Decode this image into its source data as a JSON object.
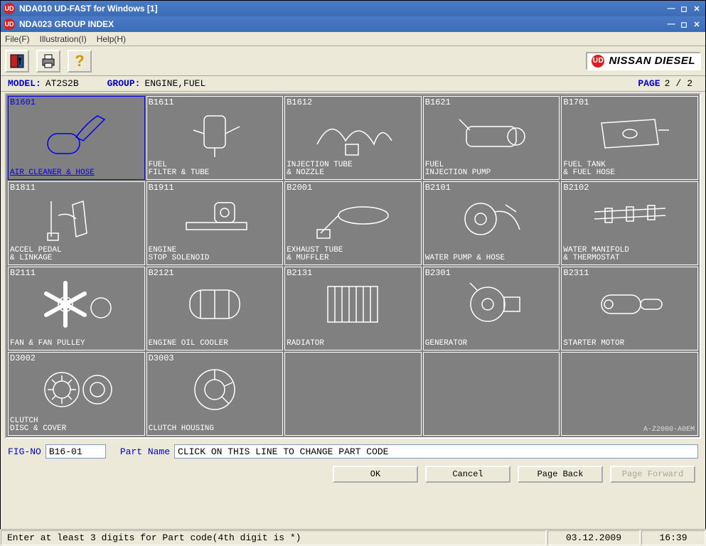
{
  "outer_window": {
    "title": "NDA010 UD-FAST for Windows [1]"
  },
  "inner_window": {
    "title": "NDA023 GROUP INDEX"
  },
  "menu": {
    "file": "File(F)",
    "illustration": "Illustration(I)",
    "help": "Help(H)"
  },
  "toolbar": {
    "exit_tip": "Exit",
    "print_tip": "Print",
    "help_tip": "Help"
  },
  "brand": "NISSAN DIESEL",
  "header": {
    "model_label": "MODEL:",
    "model_value": "AT2S2B",
    "group_label": "GROUP:",
    "group_value": "ENGINE,FUEL",
    "page_label": "PAGE",
    "page_current": "2",
    "page_sep": "/",
    "page_total": "2"
  },
  "cells": [
    {
      "code": "B1601",
      "label": "AIR CLEANER & HOSE",
      "selected": true
    },
    {
      "code": "B1611",
      "label": "FUEL\nFILTER & TUBE"
    },
    {
      "code": "B1612",
      "label": "INJECTION TUBE\n& NOZZLE"
    },
    {
      "code": "B1621",
      "label": "FUEL\nINJECTION PUMP"
    },
    {
      "code": "B1701",
      "label": "FUEL TANK\n& FUEL HOSE"
    },
    {
      "code": "B1811",
      "label": "ACCEL PEDAL\n& LINKAGE"
    },
    {
      "code": "B1911",
      "label": "ENGINE\nSTOP SOLENOID"
    },
    {
      "code": "B2001",
      "label": "EXHAUST TUBE\n& MUFFLER"
    },
    {
      "code": "B2101",
      "label": "WATER PUMP & HOSE"
    },
    {
      "code": "B2102",
      "label": "WATER MANIFOLD\n& THERMOSTAT"
    },
    {
      "code": "B2111",
      "label": "FAN & FAN PULLEY"
    },
    {
      "code": "B2121",
      "label": "ENGINE OIL COOLER"
    },
    {
      "code": "B2131",
      "label": "RADIATOR"
    },
    {
      "code": "B2301",
      "label": "GENERATOR"
    },
    {
      "code": "B2311",
      "label": "STARTER MOTOR"
    },
    {
      "code": "D3002",
      "label": "CLUTCH\nDISC & COVER"
    },
    {
      "code": "D3003",
      "label": "CLUTCH HOUSING"
    },
    {
      "code": "",
      "label": "",
      "empty": true
    },
    {
      "code": "",
      "label": "",
      "empty": true
    },
    {
      "code": "",
      "label": "",
      "empty": true
    }
  ],
  "watermark": "A-Z2000-A0EM",
  "fig": {
    "label": "FIG-NO",
    "value": "B16-01"
  },
  "partname": {
    "label": "Part Name",
    "value": "CLICK ON THIS LINE TO CHANGE PART CODE"
  },
  "buttons": {
    "ok": "OK",
    "cancel": "Cancel",
    "back": "Page Back",
    "forward": "Page Forward"
  },
  "status": {
    "msg": "Enter at least 3 digits for Part code(4th digit is *)",
    "date": "03.12.2009",
    "time": "16:39"
  }
}
